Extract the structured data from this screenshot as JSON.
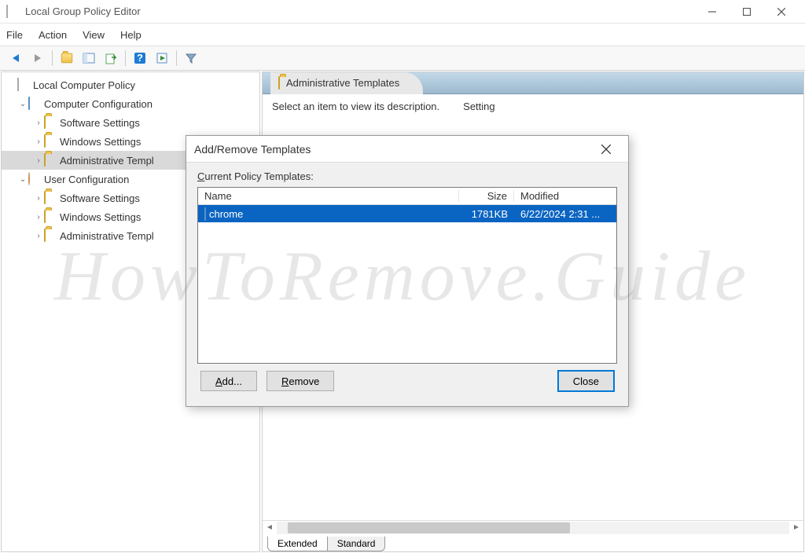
{
  "window": {
    "title": "Local Group Policy Editor"
  },
  "menu": {
    "file": "File",
    "action": "Action",
    "view": "View",
    "help": "Help"
  },
  "tree": {
    "root": "Local Computer Policy",
    "comp_config": "Computer Configuration",
    "comp_software": "Software Settings",
    "comp_windows": "Windows Settings",
    "comp_admin": "Administrative Templ",
    "user_config": "User Configuration",
    "user_software": "Software Settings",
    "user_windows": "Windows Settings",
    "user_admin": "Administrative Templ"
  },
  "content": {
    "header": "Administrative Templates",
    "desc": "Select an item to view its description.",
    "setting_col": "Setting",
    "tab_extended": "Extended",
    "tab_standard": "Standard"
  },
  "dialog": {
    "title": "Add/Remove Templates",
    "label_prefix": "C",
    "label_rest": "urrent Policy Templates:",
    "cols": {
      "name": "Name",
      "size": "Size",
      "modified": "Modified"
    },
    "rows": [
      {
        "name": "chrome",
        "size": "1781KB",
        "modified": "6/22/2024 2:31 ..."
      }
    ],
    "btn_add_u": "A",
    "btn_add_rest": "dd...",
    "btn_remove_u": "R",
    "btn_remove_rest": "emove",
    "btn_close": "Close"
  },
  "watermark": "HowToRemove.Guide"
}
